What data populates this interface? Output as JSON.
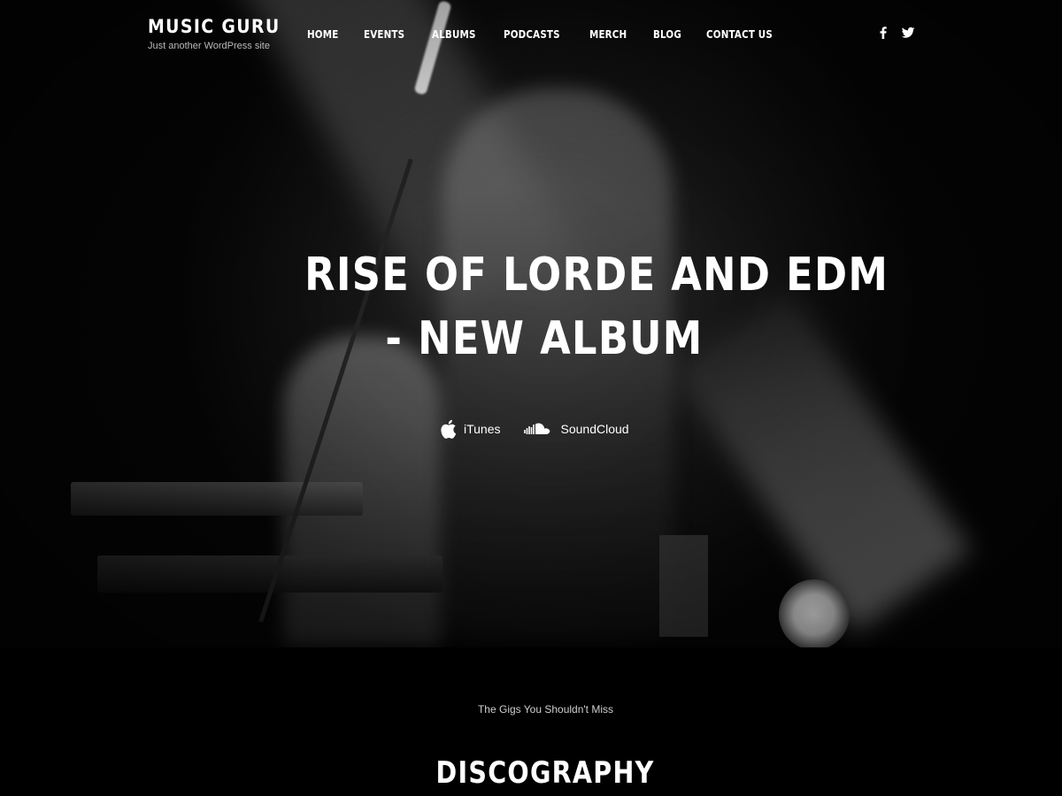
{
  "brand": {
    "title": "MUSIC GURU",
    "tagline": "Just another WordPress site"
  },
  "nav": {
    "items": [
      "HOME",
      "EVENTS",
      "ALBUMS",
      "PODCASTS",
      "MERCH",
      "BLOG",
      "CONTACT US"
    ]
  },
  "social": {
    "icons": [
      "facebook-icon",
      "twitter-icon"
    ]
  },
  "hero": {
    "title_line1": "RISE OF LORDE AND EDM",
    "title_line2": "- NEW ALBUM",
    "stores": [
      {
        "label": "iTunes",
        "icon": "apple-icon"
      },
      {
        "label": "SoundCloud",
        "icon": "soundcloud-icon"
      }
    ]
  },
  "section": {
    "subtitle": "The Gigs You Shouldn't Miss",
    "title": "DISCOGRAPHY"
  },
  "colors": {
    "background": "#000000",
    "text": "#ffffff",
    "muted": "#bbbbbb"
  }
}
